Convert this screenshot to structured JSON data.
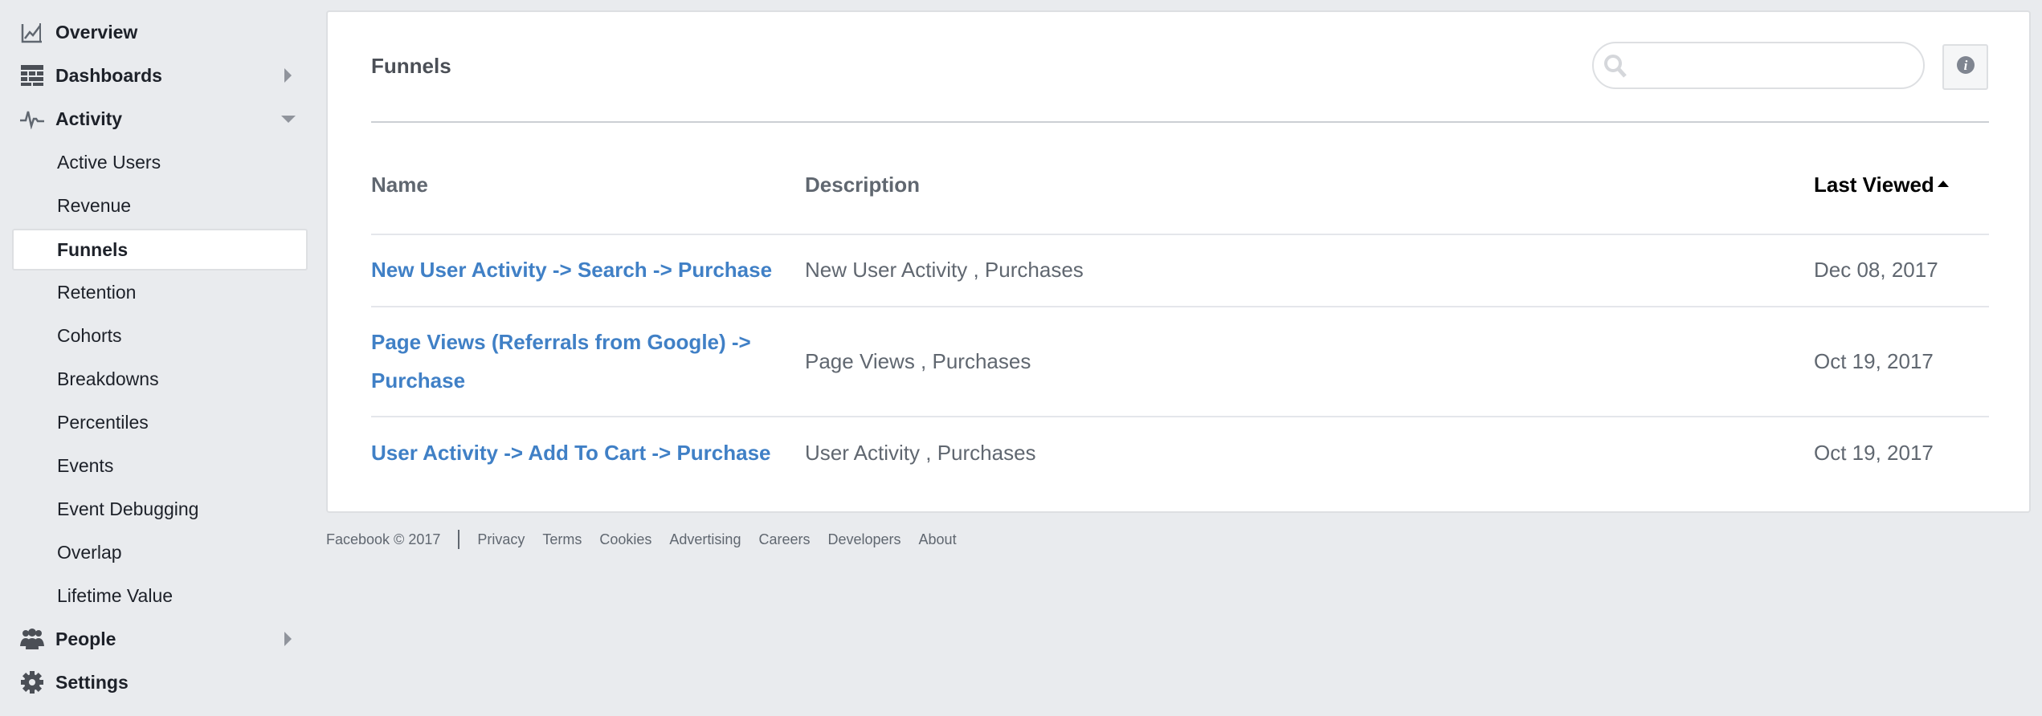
{
  "sidebar": {
    "overview": {
      "label": "Overview",
      "icon": "chart-icon"
    },
    "dashboards": {
      "label": "Dashboards",
      "icon": "grid-icon"
    },
    "activity": {
      "label": "Activity",
      "icon": "pulse-icon",
      "expanded": true,
      "items": [
        {
          "label": "Active Users"
        },
        {
          "label": "Revenue"
        },
        {
          "label": "Funnels",
          "selected": true
        },
        {
          "label": "Retention"
        },
        {
          "label": "Cohorts"
        },
        {
          "label": "Breakdowns"
        },
        {
          "label": "Percentiles"
        },
        {
          "label": "Events"
        },
        {
          "label": "Event Debugging"
        },
        {
          "label": "Overlap"
        },
        {
          "label": "Lifetime Value"
        }
      ]
    },
    "people": {
      "label": "People",
      "icon": "people-icon"
    },
    "settings": {
      "label": "Settings",
      "icon": "gear-icon"
    }
  },
  "main": {
    "title": "Funnels",
    "search": {
      "value": "",
      "placeholder": ""
    },
    "table": {
      "columns": [
        "Name",
        "Description",
        "Last Viewed"
      ],
      "sort": {
        "column": "Last Viewed",
        "direction": "ascending"
      },
      "rows": [
        {
          "name": "New User Activity -> Search -> Purchase",
          "description": "New User Activity , Purchases",
          "last_viewed": "Dec 08, 2017"
        },
        {
          "name": "Page Views (Referrals from Google) -> Purchase",
          "description": "Page Views , Purchases",
          "last_viewed": "Oct 19, 2017"
        },
        {
          "name": "User Activity -> Add To Cart -> Purchase",
          "description": "User Activity , Purchases",
          "last_viewed": "Oct 19, 2017"
        }
      ]
    }
  },
  "footer": {
    "copyright": "Facebook © 2017",
    "links": [
      "Privacy",
      "Terms",
      "Cookies",
      "Advertising",
      "Careers",
      "Developers",
      "About"
    ]
  },
  "colors": {
    "background": "#e9ebee",
    "link": "#4080c6",
    "muted_text": "#606770",
    "border": "#dddfe2"
  }
}
